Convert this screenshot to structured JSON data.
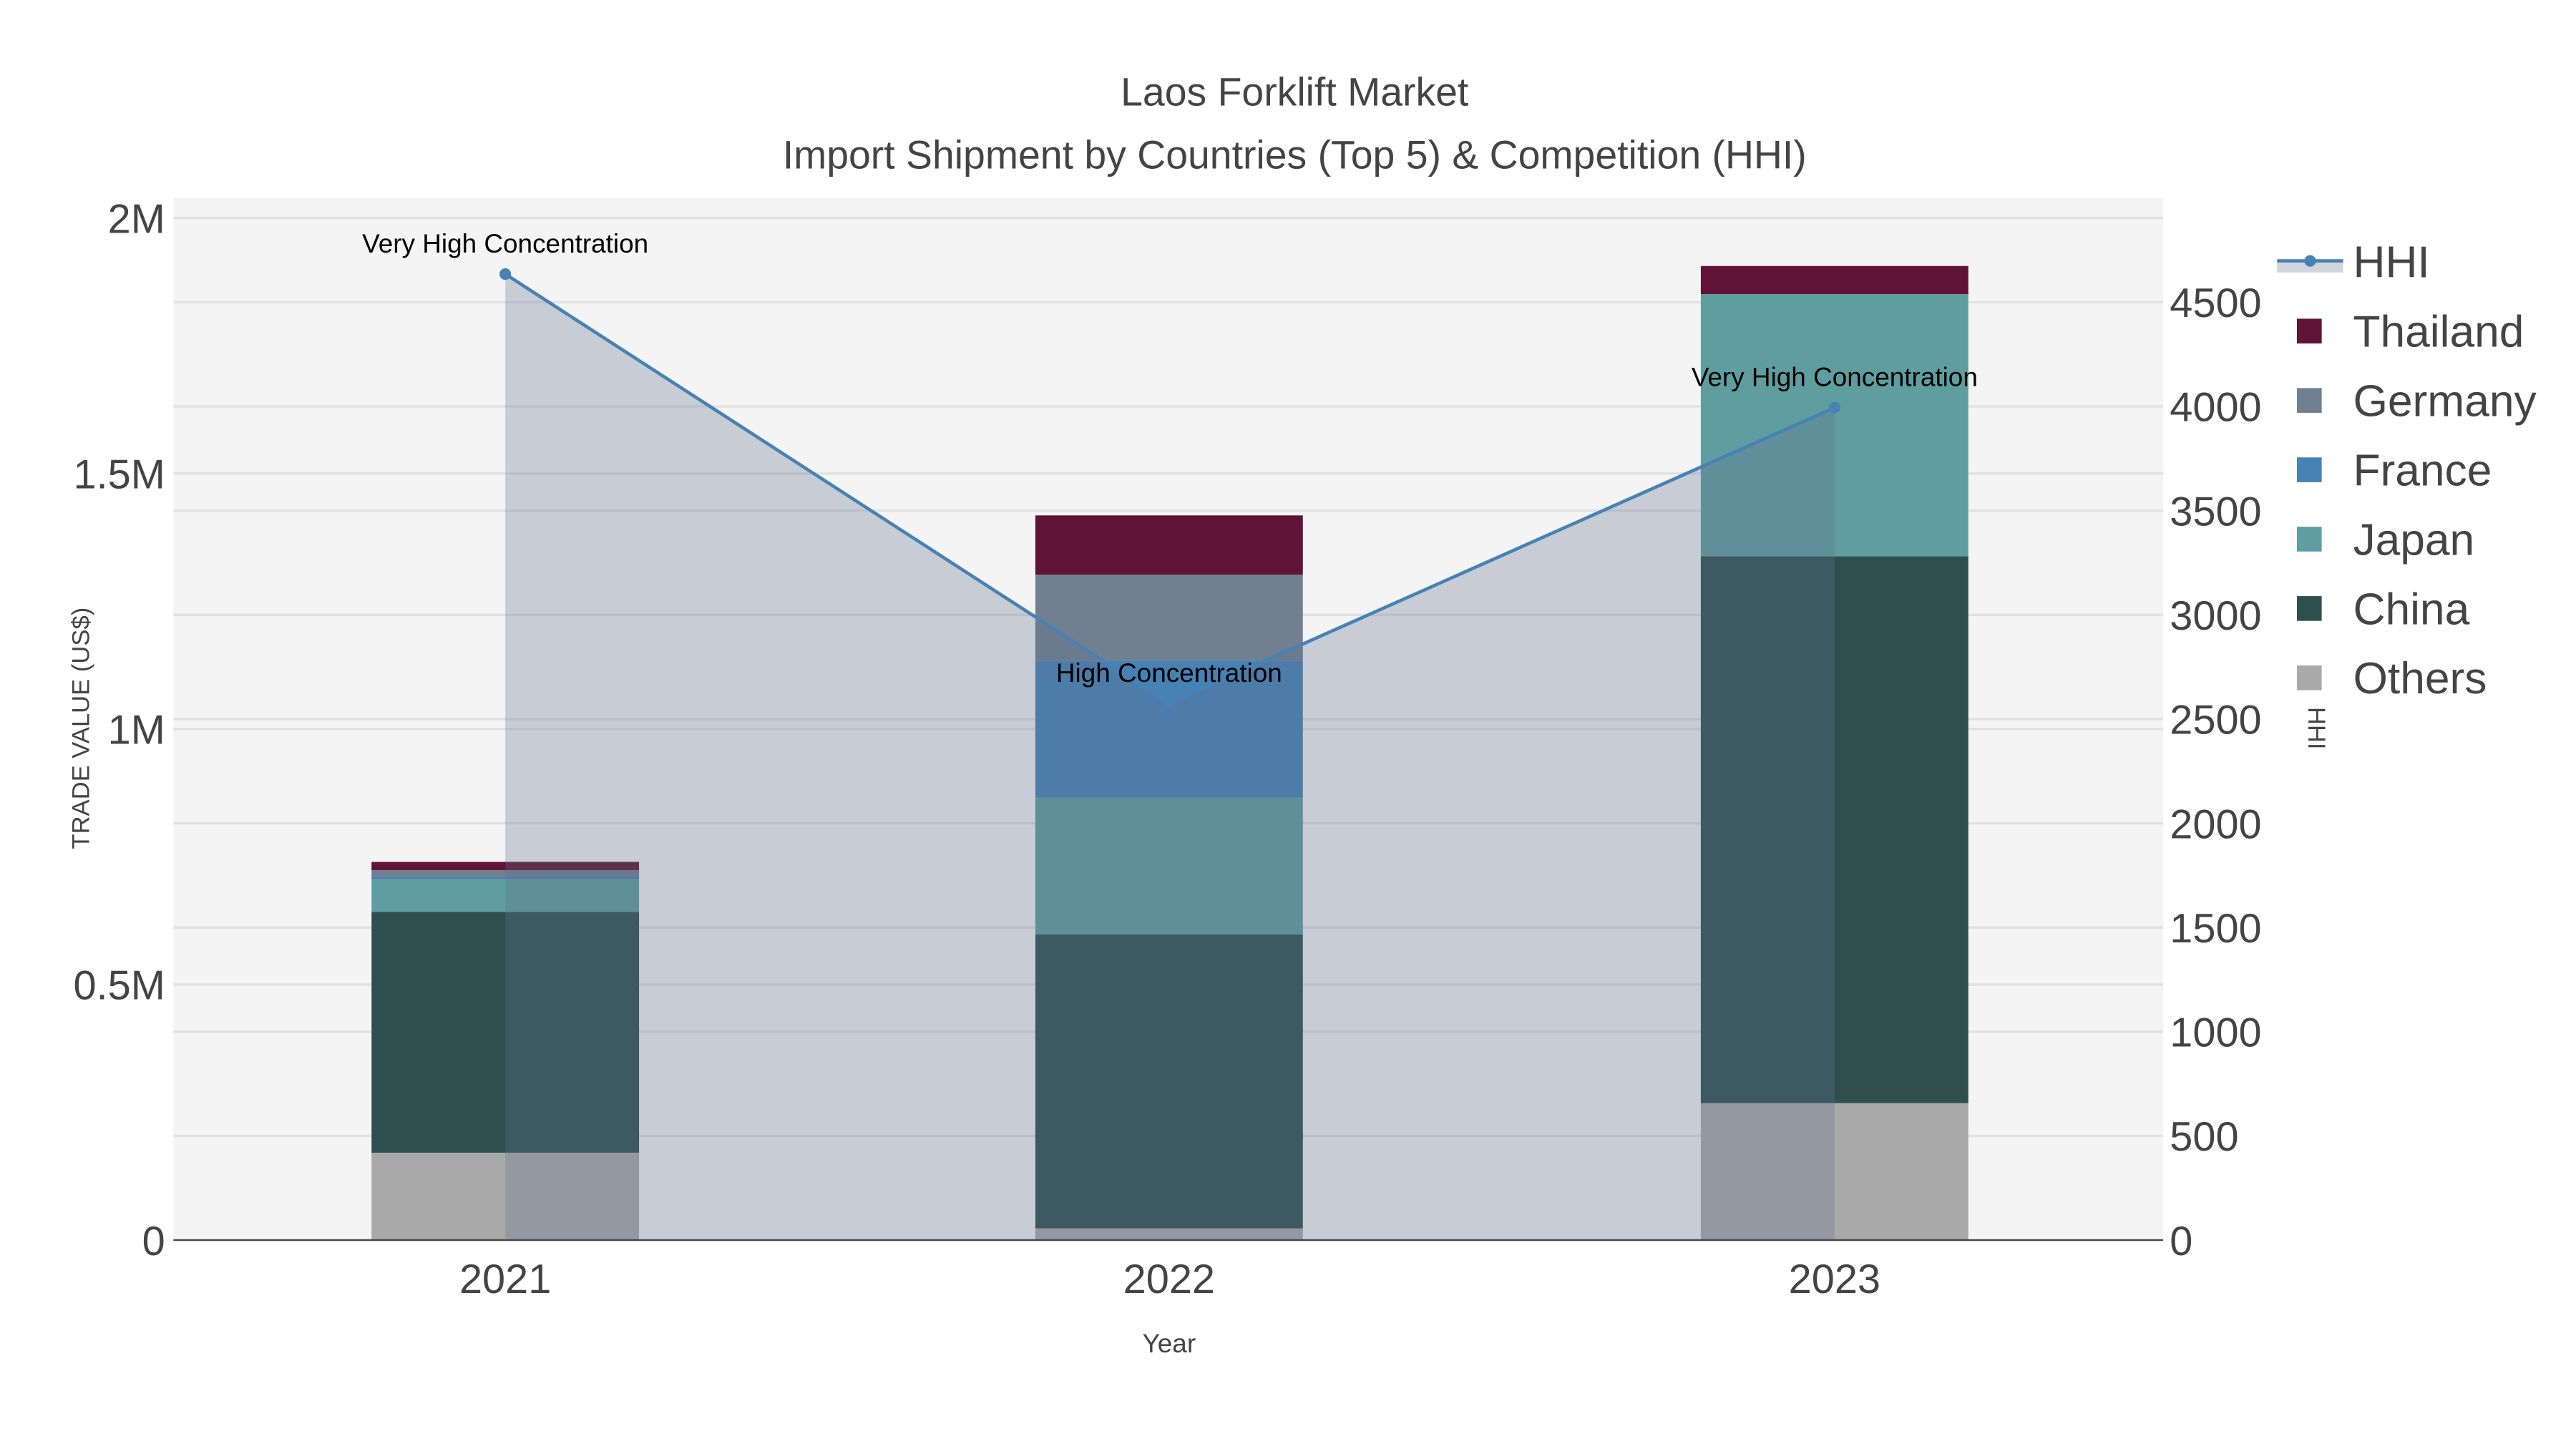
{
  "chart_data": {
    "type": "bar",
    "title": "Laos Forklift Market",
    "subtitle": "Import Shipment by Countries (Top 5) & Competition (HHI)",
    "xlabel": "Year",
    "ylabel": "TRADE VALUE (US$)",
    "y2label": "HHI",
    "categories": [
      "2021",
      "2022",
      "2023"
    ],
    "ylim": [
      0,
      2000000
    ],
    "y2lim": [
      0,
      4900
    ],
    "y_ticks": [
      {
        "v": 0,
        "label": "0"
      },
      {
        "v": 500000,
        "label": "0.5M"
      },
      {
        "v": 1000000,
        "label": "1M"
      },
      {
        "v": 1500000,
        "label": "1.5M"
      },
      {
        "v": 2000000,
        "label": "2M"
      }
    ],
    "y2_ticks": [
      0,
      500,
      1000,
      1500,
      2000,
      2500,
      3000,
      3500,
      4000,
      4500
    ],
    "grid": true,
    "legend_position": "right",
    "stack_order": [
      "Others",
      "China",
      "Japan",
      "France",
      "Germany",
      "Thailand"
    ],
    "series": [
      {
        "name": "Others",
        "color": "#a9a9a9",
        "values": [
          171000,
          23000,
          268000
        ]
      },
      {
        "name": "China",
        "color": "#2f4f4f",
        "values": [
          471000,
          575000,
          1070000
        ]
      },
      {
        "name": "Japan",
        "color": "#5f9ea0",
        "values": [
          64000,
          268000,
          513000
        ]
      },
      {
        "name": "France",
        "color": "#4682b4",
        "values": [
          4000,
          268000,
          0
        ]
      },
      {
        "name": "Germany",
        "color": "#708090",
        "values": [
          14000,
          168000,
          0
        ]
      },
      {
        "name": "Thailand",
        "color": "#5f1336",
        "values": [
          16000,
          116000,
          55000
        ]
      }
    ],
    "hhi": {
      "name": "HHI",
      "color": "#4682b4",
      "values": [
        4635,
        2575,
        3994
      ]
    },
    "annotations": [
      "Very High Concentration",
      "High Concentration",
      "Very High Concentration"
    ],
    "legend": [
      "HHI",
      "Thailand",
      "Germany",
      "France",
      "Japan",
      "China",
      "Others"
    ]
  }
}
